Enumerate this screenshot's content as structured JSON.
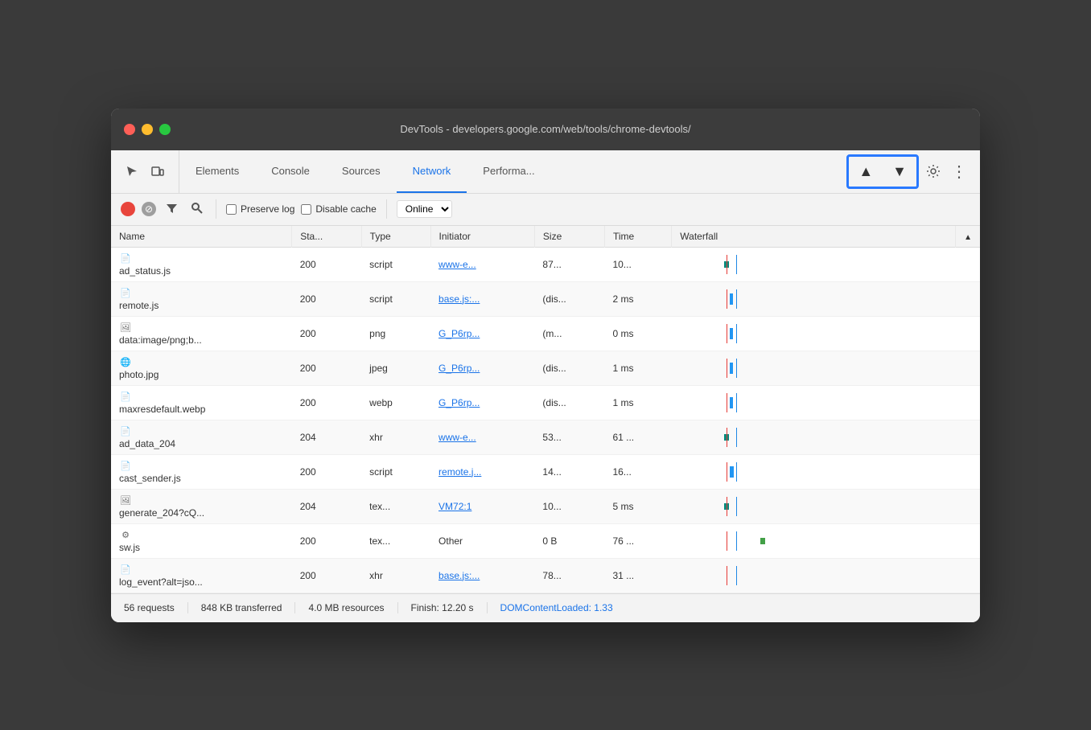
{
  "window": {
    "title": "DevTools - developers.google.com/web/tools/chrome-devtools/"
  },
  "tabs": [
    {
      "label": "Elements",
      "active": false
    },
    {
      "label": "Console",
      "active": false
    },
    {
      "label": "Sources",
      "active": false
    },
    {
      "label": "Network",
      "active": true
    },
    {
      "label": "Performa...",
      "active": false
    }
  ],
  "filter_bar": {
    "preserve_log_label": "Preserve log",
    "disable_cache_label": "Disable cache",
    "online_label": "Online"
  },
  "highlight": {
    "upload_icon": "↑",
    "download_icon": "↓"
  },
  "table": {
    "columns": [
      "Name",
      "Sta...",
      "Type",
      "Initiator",
      "Size",
      "Time",
      "Waterfall",
      ""
    ],
    "rows": [
      {
        "name": "ad_status.js",
        "status": "200",
        "type": "script",
        "initiator": "www-e...",
        "size": "87...",
        "time": "10...",
        "icon": "doc"
      },
      {
        "name": "remote.js",
        "status": "200",
        "type": "script",
        "initiator": "base.js:...",
        "initiator_extra": "(dis...",
        "size": "2 ms",
        "time": "",
        "icon": "doc"
      },
      {
        "name": "data:image/png;b...",
        "status": "200",
        "type": "png",
        "initiator": "G_P6rp...",
        "initiator_extra": "(m...",
        "size": "0 ms",
        "time": "",
        "icon": "img"
      },
      {
        "name": "photo.jpg",
        "status": "200",
        "type": "jpeg",
        "initiator": "G_P6rp...",
        "initiator_extra": "(dis...",
        "size": "1 ms",
        "time": "",
        "icon": "photo"
      },
      {
        "name": "maxresdefault.webp",
        "status": "200",
        "type": "webp",
        "initiator": "G_P6rp...",
        "initiator_extra": "(dis...",
        "size": "1 ms",
        "time": "",
        "icon": "img"
      },
      {
        "name": "ad_data_204",
        "status": "204",
        "type": "xhr",
        "initiator": "www-e...",
        "size": "53...",
        "time": "61 ...",
        "icon": "doc"
      },
      {
        "name": "cast_sender.js",
        "status": "200",
        "type": "script",
        "initiator": "remote.j...",
        "size": "14...",
        "time": "16...",
        "icon": "doc"
      },
      {
        "name": "generate_204?cQ...",
        "status": "204",
        "type": "tex...",
        "initiator": "VM72:1",
        "size": "10...",
        "time": "5 ms",
        "icon": "img-doc"
      },
      {
        "name": "sw.js",
        "status": "200",
        "type": "tex...",
        "initiator": "Other",
        "size": "0 B",
        "time": "76 ...",
        "icon": "gear"
      },
      {
        "name": "log_event?alt=jso...",
        "status": "200",
        "type": "xhr",
        "initiator": "base.js:...",
        "size": "78...",
        "time": "31 ...",
        "icon": "doc"
      }
    ]
  },
  "status_bar": {
    "requests": "56 requests",
    "transferred": "848 KB transferred",
    "resources": "4.0 MB resources",
    "finish": "Finish: 12.20 s",
    "dom_content": "DOMContentLoaded: 1.33"
  }
}
